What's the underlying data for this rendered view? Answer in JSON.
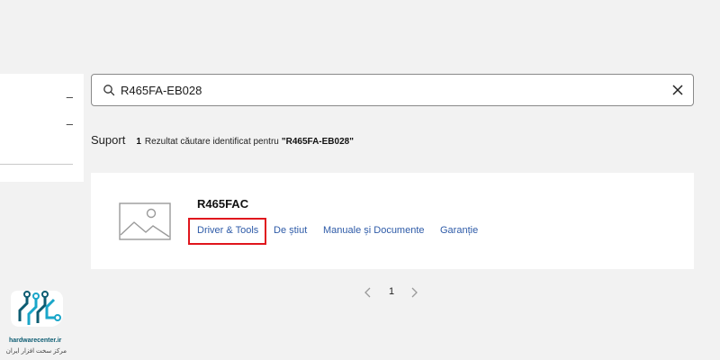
{
  "search": {
    "value": "R465FA-EB028",
    "clear_label": "✕"
  },
  "filters": {
    "toggle_1": "–",
    "toggle_2": "–"
  },
  "results": {
    "title": "Suport",
    "count": "1",
    "text": "Rezultat căutare identificat pentru",
    "query": "\"R465FA-EB028\""
  },
  "product": {
    "name": "R465FAC",
    "links": [
      "Driver & Tools",
      "De știut",
      "Manuale și Documente",
      "Garanție"
    ]
  },
  "pagination": {
    "current": "1"
  },
  "watermark": {
    "site": "hardwarecenter.ir",
    "subtitle": "مرکز سخت افزار ایران"
  },
  "colors": {
    "background": "#f2f2f2",
    "link": "#2e5ba8",
    "highlight": "#e0161d",
    "logo": "#0c5c72"
  }
}
